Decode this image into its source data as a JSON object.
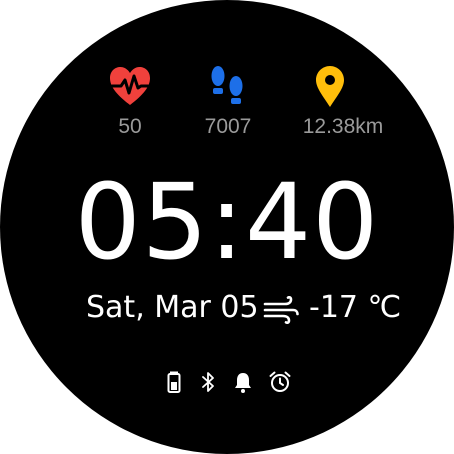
{
  "stats": {
    "heart_rate": "50",
    "steps": "7007",
    "distance": "12.38km"
  },
  "time": "05:40",
  "date": "Sat, Mar 05",
  "weather": {
    "icon": "wind-icon",
    "temperature": "-17 ℃"
  },
  "status_icons": [
    "battery-icon",
    "bluetooth-icon",
    "bell-icon",
    "alarm-clock-icon"
  ],
  "colors": {
    "background": "#000000",
    "heart": "#f0413c",
    "steps": "#1d6fe8",
    "location": "#ffbe0b",
    "stat_text": "#9a9a9a",
    "primary_text": "#ffffff"
  }
}
